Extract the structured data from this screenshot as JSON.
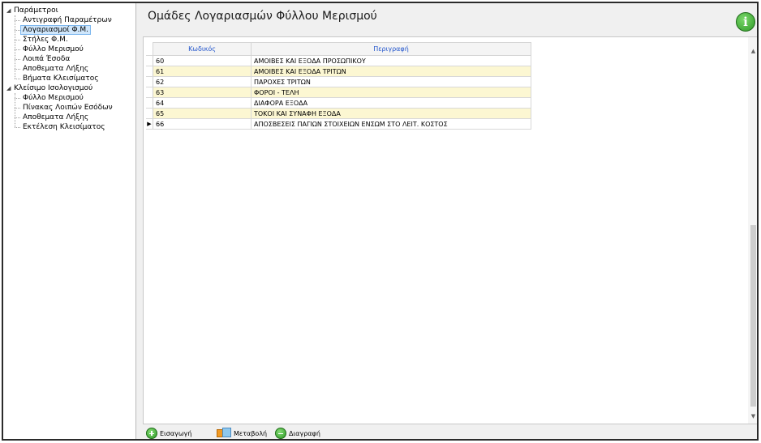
{
  "window": {
    "title": "Ομάδες Λογαριασμών Φύλλου Μερισμού"
  },
  "tree": {
    "groups": [
      {
        "label": "Παράμετροι",
        "children": [
          "Αντιγραφή Παραμέτρων",
          "Λογαριασμοί Φ.Μ.",
          "Στήλες Φ.Μ.",
          "Φύλλο Μερισμού",
          "Λοιπά Έσοδα",
          "Αποθεματα Λήξης",
          "Βήματα Κλεισίματος"
        ]
      },
      {
        "label": "Κλείσιμο Ισολογισμού",
        "children": [
          "Φύλλο Μερισμού",
          "Πίνακας Λοιπών Εσόδων",
          "Αποθεματα Λήξης",
          "Εκτέλεση Κλεισίματος"
        ]
      }
    ],
    "selected": "Λογαριασμοί Φ.Μ."
  },
  "grid": {
    "columns": [
      "Κωδικός",
      "Περιγραφή"
    ],
    "rows": [
      {
        "code": "60",
        "desc": "ΑΜΟΙΒΕΣ ΚΑΙ ΕΞΟΔΑ ΠΡΟΣΩΠΙΚΟΥ"
      },
      {
        "code": "61",
        "desc": "ΑΜΟΙΒΕΣ ΚΑΙ ΕΞΟΔΑ ΤΡΙΤΩΝ"
      },
      {
        "code": "62",
        "desc": "ΠΑΡΟΧΕΣ ΤΡΙΤΩΝ"
      },
      {
        "code": "63",
        "desc": "ΦΟΡΟΙ - ΤΕΛΗ"
      },
      {
        "code": "64",
        "desc": "ΔΙΑΦΟΡΑ ΕΞΟΔΑ"
      },
      {
        "code": "65",
        "desc": "ΤΟΚΟΙ ΚΑΙ ΣΥΝΑΦΗ ΕΞΟΔΑ"
      },
      {
        "code": "66",
        "desc": "ΑΠΟΣΒΕΣΕΙΣ ΠΑΓΙΩΝ ΣΤΟΙΧΕΙΩΝ ΕΝΣΩΜ ΣΤΟ ΛΕΙΤ. ΚΟΣΤΟΣ"
      }
    ],
    "current_row_indicator": "▶",
    "row_highlight_color": "#fcf7d2",
    "header_text_color": "#2255cc"
  },
  "toolbar": {
    "insert_label": "Εισαγωγή",
    "edit_label": "Μεταβολή",
    "delete_label": "Διαγραφή"
  },
  "info_icon": "i"
}
